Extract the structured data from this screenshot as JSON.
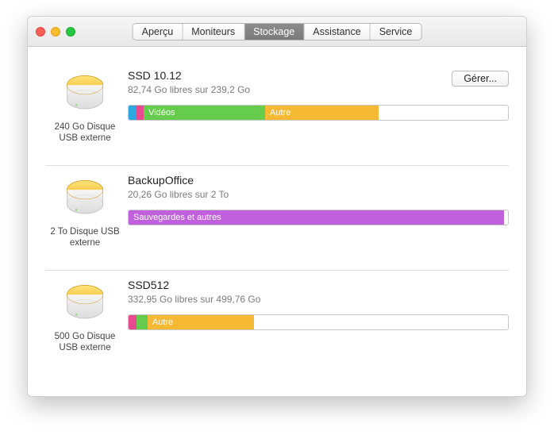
{
  "tabs": {
    "apercu": "Aperçu",
    "moniteurs": "Moniteurs",
    "stockage": "Stockage",
    "assistance": "Assistance",
    "service": "Service"
  },
  "manage_label": "Gérer...",
  "drives": [
    {
      "name": "SSD 10.12",
      "subtitle": "82,74 Go libres sur 239,2 Go",
      "caption": "240 Go Disque USB externe",
      "has_manage": true,
      "segments": [
        {
          "label": "",
          "width": "2%",
          "color": "#2ea7e0"
        },
        {
          "label": "",
          "width": "2%",
          "color": "#e74a8e"
        },
        {
          "label": "Vidéos",
          "width": "32%",
          "color": "#66cc4d"
        },
        {
          "label": "Autre",
          "width": "30%",
          "color": "#f5b933"
        }
      ]
    },
    {
      "name": "BackupOffice",
      "subtitle": "20,26 Go libres sur 2 To",
      "caption": "2 To Disque USB externe",
      "has_manage": false,
      "segments": [
        {
          "label": "Sauvegardes et autres",
          "width": "99%",
          "color": "#c160dc"
        }
      ]
    },
    {
      "name": "SSD512",
      "subtitle": "332,95 Go libres sur 499,76 Go",
      "caption": "500 Go Disque USB externe",
      "has_manage": false,
      "segments": [
        {
          "label": "",
          "width": "2%",
          "color": "#e74a8e"
        },
        {
          "label": "",
          "width": "3%",
          "color": "#66cc4d"
        },
        {
          "label": "Autre",
          "width": "28%",
          "color": "#f5b933"
        }
      ]
    }
  ]
}
